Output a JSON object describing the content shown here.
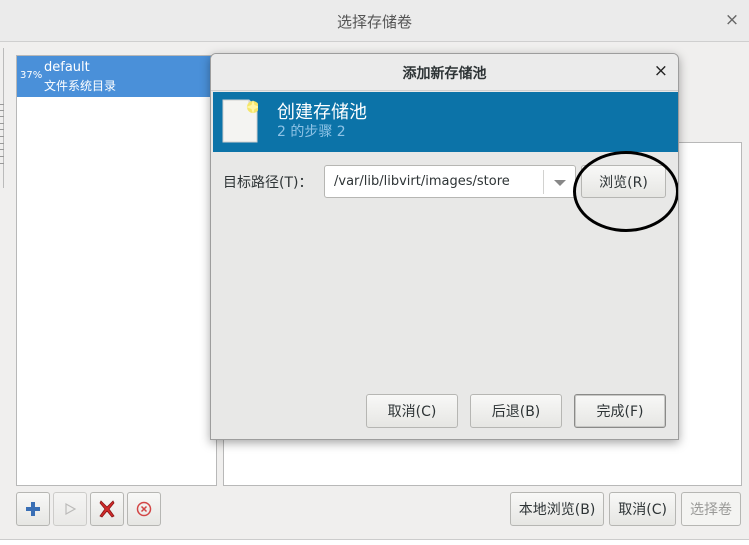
{
  "window": {
    "title": "选择存储卷",
    "close_glyph": "×"
  },
  "pool_list": {
    "items": [
      {
        "usage": "37%",
        "name": "default",
        "type": "文件系统目录"
      }
    ]
  },
  "toolbar_left": {
    "buttons": [
      {
        "icon": "add-icon"
      },
      {
        "icon": "play-icon"
      },
      {
        "icon": "delete-icon"
      },
      {
        "icon": "stop-icon"
      }
    ]
  },
  "footer": {
    "browse_local": "本地浏览(B)",
    "cancel": "取消(C)",
    "choose_volume": "选择卷"
  },
  "dialog": {
    "title": "添加新存储池",
    "close_glyph": "×",
    "banner": {
      "heading": "创建存储池",
      "step": "2 的步骤 2"
    },
    "target_path_label": "目标路径(T)：",
    "target_path_value": "/var/lib/libvirt/images/store",
    "browse": "浏览(R)",
    "cancel": "取消(C)",
    "back": "后退(B)",
    "finish": "完成(F)"
  },
  "colors": {
    "banner": "#0c73a8",
    "selection": "#4a90d9",
    "annotation_circle": "#000000"
  }
}
